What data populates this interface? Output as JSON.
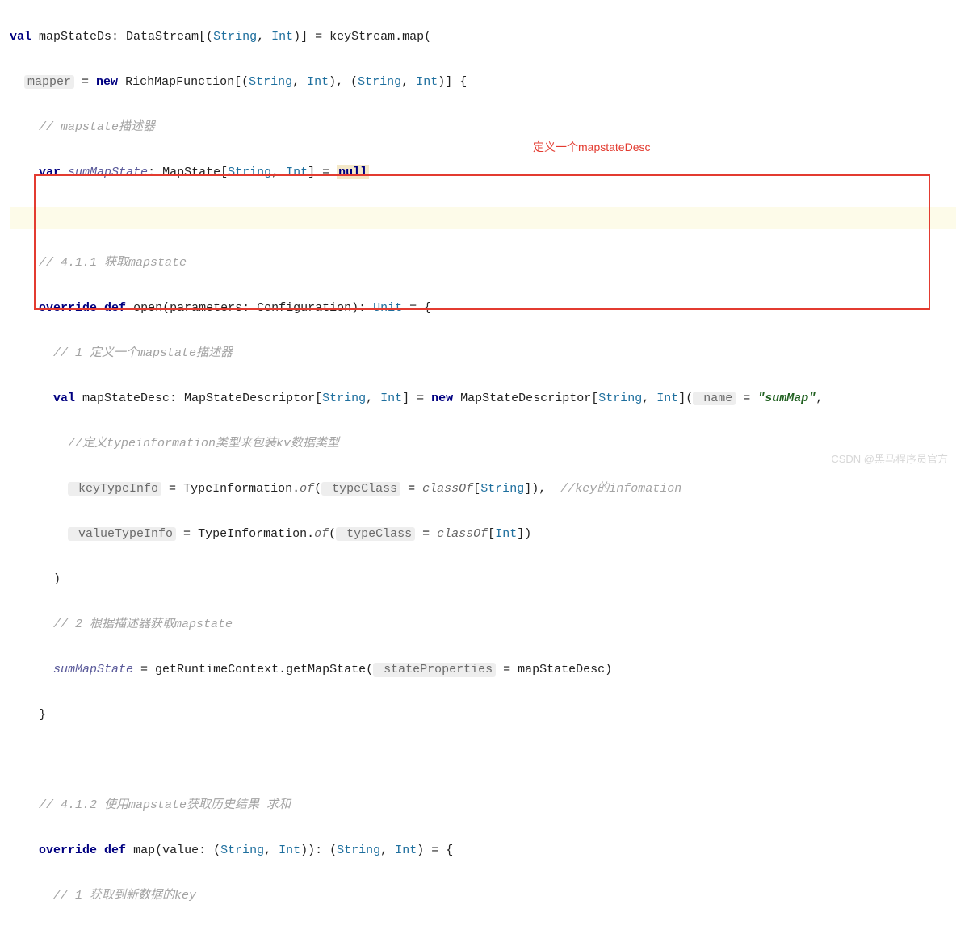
{
  "line1": {
    "val": "val",
    "name": " mapStateDs: DataStream[(",
    "str": "String",
    "c1": ", ",
    "int": "Int",
    "c2": ")] = keyStream.map("
  },
  "line2": {
    "mapper": "mapper",
    "eq": " = ",
    "new": "new",
    "rest1": " RichMapFunction[(",
    "str1": "String",
    "c1": ", ",
    "int1": "Int",
    "c2": "), (",
    "str2": "String",
    "c3": ", ",
    "int2": "Int",
    "c4": ")] {"
  },
  "line3": {
    "comment": "// mapstate描述器"
  },
  "line4": {
    "var": "var",
    "sp": " ",
    "name": "sumMapState",
    "colon": ": MapState[",
    "str": "String",
    "c1": ", ",
    "int": "Int",
    "c2": "] = ",
    "null": "null"
  },
  "line6": {
    "comment": "// 4.1.1 获取mapstate"
  },
  "line7": {
    "override": "override",
    "sp": " ",
    "def": "def",
    "rest1": " open(parameters: Configuration): ",
    "unit": "Unit",
    "rest2": " = {"
  },
  "line8": {
    "comment": "// 1 定义一个mapstate描述器"
  },
  "line9": {
    "val": "val",
    "rest1": " mapStateDesc: MapStateDescriptor[",
    "str1": "String",
    "c1": ", ",
    "int1": "Int",
    "c2": "] = ",
    "new": "new",
    "rest2": " MapStateDescriptor[",
    "str2": "String",
    "c3": ", ",
    "int2": "Int",
    "c4": "](",
    "namep": " name",
    "eq": " = ",
    "strv": "\"sumMap\"",
    "c5": ","
  },
  "line10": {
    "comment": "//定义typeinformation类型来包装kv数据类型"
  },
  "line11": {
    "kti": " keyTypeInfo",
    "eq": " = ",
    "ti": "TypeInformation.",
    "of": "of",
    "op": "(",
    "tc": " typeClass",
    "eq2": " = ",
    "co": "classOf",
    "op2": "[",
    "str": "String",
    "cl": "]),  ",
    "comment": "//key的infomation"
  },
  "line12": {
    "vti": " valueTypeInfo",
    "eq": " = ",
    "ti": "TypeInformation.",
    "of": "of",
    "op": "(",
    "tc": " typeClass",
    "eq2": " = ",
    "co": "classOf",
    "op2": "[",
    "int": "Int",
    "cl": "])"
  },
  "line13": {
    "cl": ")"
  },
  "line14": {
    "comment": "// 2 根据描述器获取mapstate"
  },
  "line15": {
    "name": "sumMapState",
    "rest1": " = getRuntimeContext.getMapState(",
    "sp": " stateProperties",
    "eq": " = ",
    "rest2": "mapStateDesc)"
  },
  "line16": {
    "cl": "}"
  },
  "line18": {
    "comment": "// 4.1.2 使用mapstate获取历史结果 求和"
  },
  "line19": {
    "override": "override",
    "sp": " ",
    "def": "def",
    "rest1": " map(value: (",
    "str1": "String",
    "c1": ", ",
    "int1": "Int",
    "c2": ")): (",
    "str2": "String",
    "c3": ", ",
    "int2": "Int",
    "c4": ") = {"
  },
  "line20": {
    "comment": "// 1 获取到新数据的key"
  },
  "annotation": "定义一个mapstateDesc",
  "watermark": "CSDN @黑马程序员官方"
}
